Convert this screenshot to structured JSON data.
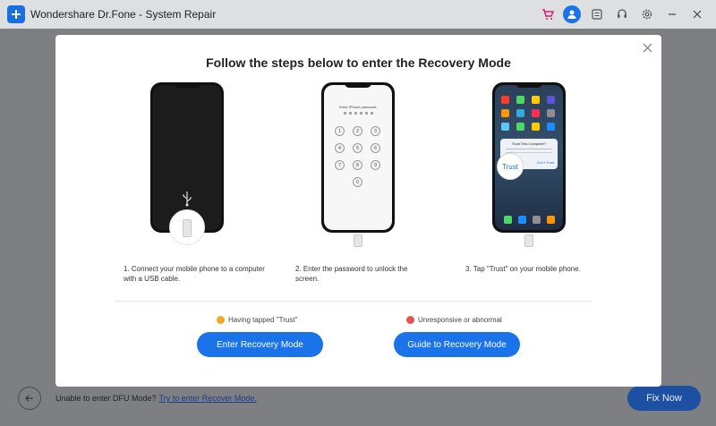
{
  "window": {
    "title": "Wondershare Dr.Fone - System Repair",
    "icons": [
      "cart-icon",
      "user-icon",
      "feedback-icon",
      "support-icon",
      "settings-icon",
      "minimize-icon",
      "close-icon"
    ],
    "accent": "#1a73e8",
    "cart_color": "#d6206e"
  },
  "modal": {
    "title": "Follow the steps below to enter the Recovery Mode",
    "steps": [
      {
        "text": "1. Connect your mobile phone to a computer with a USB cable."
      },
      {
        "text": "2. Enter the password to unlock the screen."
      },
      {
        "text": "3. Tap \"Trust\" on your mobile phone."
      }
    ],
    "phone2": {
      "passcode_label": "Enter iPhone passcode",
      "keys": [
        "1",
        "2",
        "3",
        "4",
        "5",
        "6",
        "7",
        "8",
        "9",
        "0"
      ]
    },
    "phone3": {
      "dialog_title": "Trust This Computer?",
      "trust_label": "Trust",
      "dont_trust_label": "Don't Trust"
    },
    "options": [
      {
        "hint": "Having tapped \"Trust\"",
        "button": "Enter Recovery Mode"
      },
      {
        "hint": "Unresponsive or abnormal",
        "button": "Guide to Recovery Mode"
      }
    ]
  },
  "footer": {
    "dfu_text": "Unable to enter DFU Mode?",
    "dfu_link": "Try to enter Recover Mode.",
    "fix_now": "Fix Now"
  }
}
